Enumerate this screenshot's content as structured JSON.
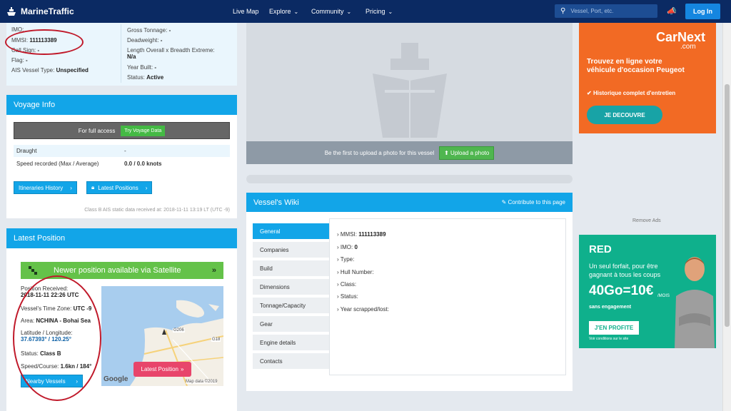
{
  "nav": {
    "brand": "MarineTraffic",
    "items": [
      {
        "label": "Live Map"
      },
      {
        "label": "Explore"
      },
      {
        "label": "Community"
      },
      {
        "label": "Pricing"
      }
    ],
    "search_placeholder": "Vessel, Port, etc.",
    "login_label": "Log In"
  },
  "general": {
    "left": [
      {
        "label": "IMO:",
        "value": ""
      },
      {
        "label": "MMSI:",
        "value": "111113389"
      },
      {
        "label": "Call Sign:",
        "value": "-"
      },
      {
        "label": "Flag:",
        "value": "-"
      },
      {
        "label": "AIS Vessel Type:",
        "value": "Unspecified"
      }
    ],
    "right": [
      {
        "label": "Gross Tonnage:",
        "value": "-"
      },
      {
        "label": "Deadweight:",
        "value": "-"
      },
      {
        "label": "Length Overall x Breadth Extreme:",
        "value": "N/a"
      },
      {
        "label": "Year Built:",
        "value": "-"
      },
      {
        "label": "Status:",
        "value": "Active"
      }
    ]
  },
  "voyage": {
    "title": "Voyage Info",
    "gate_text": "For full access",
    "gate_button": "Try Voyage Data",
    "rows": [
      {
        "label": "Draught",
        "value": "-"
      },
      {
        "label": "Speed recorded (Max / Average)",
        "value": "0.0 / 0.0 knots"
      }
    ],
    "itineraries_button": "Itineraries History",
    "latest_positions_button": "Latest Positions",
    "footer": "Class B AIS static data received at: 2018-11-11 13:19 LT (UTC -9)"
  },
  "latest": {
    "title": "Latest Position",
    "satellite_banner": "Newer position available via Satellite",
    "position_received_label": "Position Received:",
    "position_received_value": "2018-11-11 22:26 UTC",
    "timezone_label": "Vessel's Time Zone:",
    "timezone_value": "UTC -9",
    "area_label": "Area:",
    "area_value": "NCHINA - Bohai Sea",
    "latlon_label": "Latitude / Longitude:",
    "latlon_value": "37.67393° / 120.25°",
    "status_label": "Status:",
    "status_value": "Class B",
    "speed_label": "Speed/Course:",
    "speed_value": "1.6kn / 184°",
    "nearby_button": "Nearby Vessels",
    "latest_button": "Latest Position",
    "map_attribution": "Map data ©2019",
    "map_brand": "Google",
    "road_labels": [
      "G206",
      "G18"
    ]
  },
  "photo": {
    "prompt": "Be the first to upload a photo for this vessel",
    "upload_button": "Upload a photo"
  },
  "wiki": {
    "title": "Vessel's Wiki",
    "contribute": "Contribute to this page",
    "tabs": [
      {
        "label": "General"
      },
      {
        "label": "Companies"
      },
      {
        "label": "Build"
      },
      {
        "label": "Dimensions"
      },
      {
        "label": "Tonnage/Capacity"
      },
      {
        "label": "Gear"
      },
      {
        "label": "Engine details"
      },
      {
        "label": "Contacts"
      }
    ],
    "fields": [
      {
        "label": "MMSI:",
        "value": "111113389"
      },
      {
        "label": "IMO:",
        "value": "0"
      },
      {
        "label": "Type:",
        "value": ""
      },
      {
        "label": "Hull Number:",
        "value": ""
      },
      {
        "label": "Class:",
        "value": ""
      },
      {
        "label": "Status:",
        "value": ""
      },
      {
        "label": "Year scrapped/lost:",
        "value": ""
      }
    ]
  },
  "ads": {
    "ad1": {
      "brand": "CarNext",
      "brand_suffix": ".com",
      "headline": "Trouvez en ligne votre véhicule d'occasion Peugeot",
      "bullet": "Historique complet d'entretien",
      "cta": "JE DECOUVRE"
    },
    "remove_ads": "Remove Ads",
    "ad2": {
      "brand": "RED",
      "text": "Un seul forfait, pour être gagnant à tous les coups",
      "offer": "40Go=10€",
      "offer_unit": "/MOIS",
      "sub": "sans engagement",
      "cta": "J'EN PROFITE",
      "fine": "Voir conditions sur le site"
    }
  },
  "colors": {
    "nav_bg": "#0b2a63",
    "accent": "#12a5e8",
    "green": "#64c249",
    "pink": "#e8456b",
    "orange_ad": "#f26a24",
    "teal_ad": "#0fb08c"
  }
}
